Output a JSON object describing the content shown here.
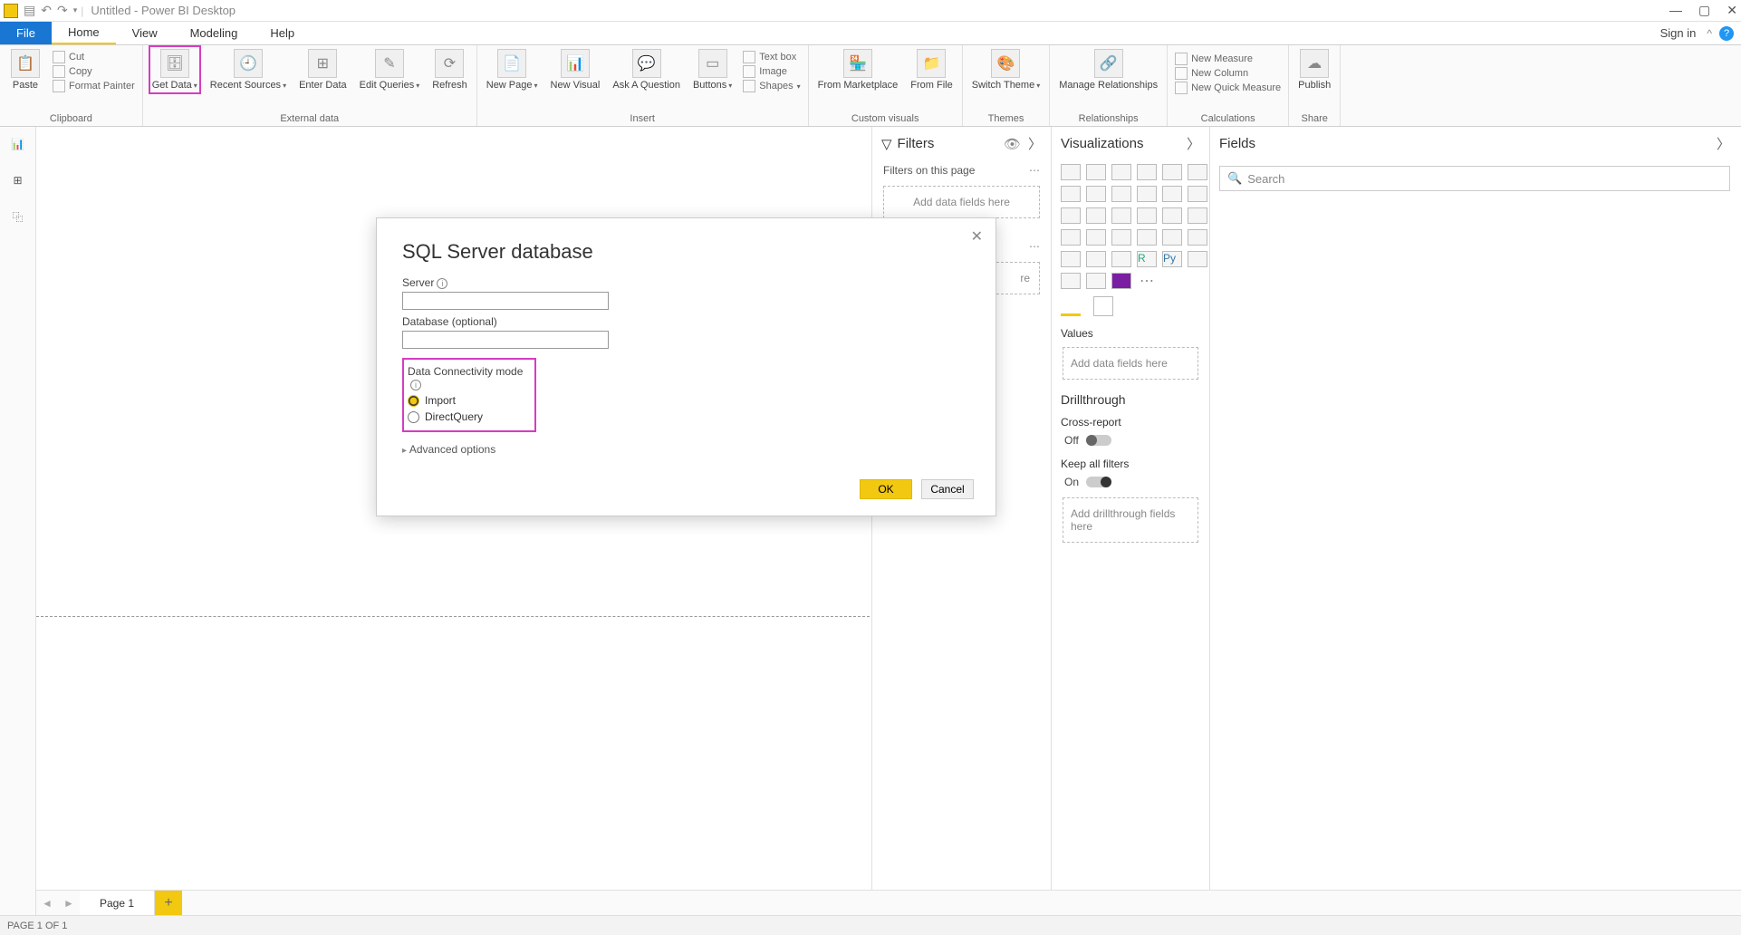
{
  "titlebar": {
    "doc_title": "Untitled - Power BI Desktop"
  },
  "menu": {
    "file": "File",
    "home": "Home",
    "view": "View",
    "modeling": "Modeling",
    "help": "Help",
    "signin": "Sign in"
  },
  "ribbon": {
    "clipboard": {
      "label": "Clipboard",
      "paste": "Paste",
      "cut": "Cut",
      "copy": "Copy",
      "format_painter": "Format Painter"
    },
    "external": {
      "label": "External data",
      "get_data": "Get\nData",
      "recent_sources": "Recent\nSources",
      "enter_data": "Enter\nData",
      "edit_queries": "Edit\nQueries",
      "refresh": "Refresh"
    },
    "insert": {
      "label": "Insert",
      "new_page": "New\nPage",
      "new_visual": "New\nVisual",
      "ask": "Ask A\nQuestion",
      "buttons": "Buttons",
      "textbox": "Text box",
      "image": "Image",
      "shapes": "Shapes"
    },
    "custom": {
      "label": "Custom visuals",
      "from_marketplace": "From\nMarketplace",
      "from_file": "From\nFile"
    },
    "themes": {
      "label": "Themes",
      "switch_theme": "Switch\nTheme"
    },
    "relationships": {
      "label": "Relationships",
      "manage": "Manage\nRelationships"
    },
    "calculations": {
      "label": "Calculations",
      "new_measure": "New Measure",
      "new_column": "New Column",
      "new_quick": "New Quick Measure"
    },
    "share": {
      "label": "Share",
      "publish": "Publish"
    }
  },
  "filters": {
    "header": "Filters",
    "sub": "Filters on this page",
    "drop": "Add data fields here"
  },
  "viz": {
    "header": "Visualizations",
    "values": "Values",
    "values_drop": "Add data fields here",
    "drill": "Drillthrough",
    "cross": "Cross-report",
    "off": "Off",
    "keep": "Keep all filters",
    "on": "On",
    "drill_drop": "Add drillthrough fields here"
  },
  "fields": {
    "header": "Fields",
    "search": "Search"
  },
  "dialog": {
    "title": "SQL Server database",
    "server_label": "Server",
    "server_value": "",
    "db_label": "Database (optional)",
    "db_value": "",
    "conn_label": "Data Connectivity mode",
    "import": "Import",
    "directquery": "DirectQuery",
    "advanced": "Advanced options",
    "ok": "OK",
    "cancel": "Cancel"
  },
  "pages": {
    "page1": "Page 1"
  },
  "status": {
    "text": "PAGE 1 OF 1"
  }
}
